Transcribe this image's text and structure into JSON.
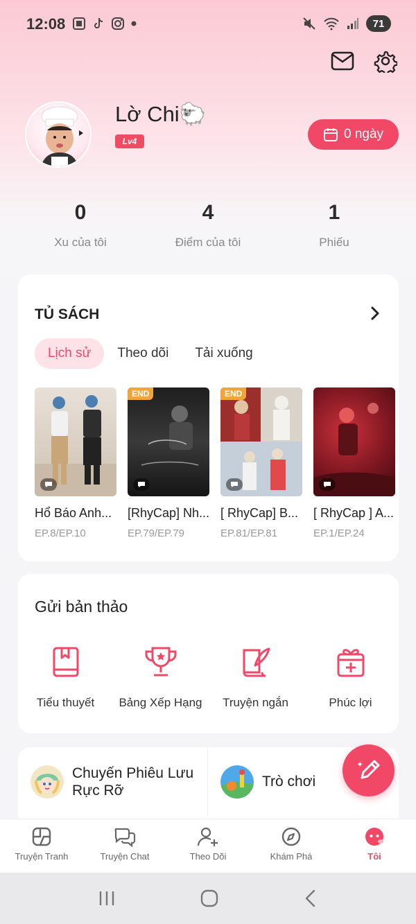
{
  "status_bar": {
    "time": "12:08",
    "battery": "71"
  },
  "profile": {
    "name": "Lờ Chi🐑",
    "level": "Lv4",
    "checkin_label": "0 ngày"
  },
  "stats": [
    {
      "value": "0",
      "label": "Xu của tôi"
    },
    {
      "value": "4",
      "label": "Điểm của tôi"
    },
    {
      "value": "1",
      "label": "Phiếu"
    }
  ],
  "bookshelf": {
    "title": "TỦ SÁCH",
    "tabs": [
      "Lịch sử",
      "Theo dõi",
      "Tải xuống"
    ],
    "active_tab": "Lịch sử",
    "books": [
      {
        "title": "Hổ Báo Anh...",
        "episode": "EP.8/EP.10",
        "tag": ""
      },
      {
        "title": "[RhyCap] Nh...",
        "episode": "EP.79/EP.79",
        "tag": "END"
      },
      {
        "title": "[ RhyCap] B...",
        "episode": "EP.81/EP.81",
        "tag": "END"
      },
      {
        "title": "[ RhyCap ] A...",
        "episode": "EP.1/EP.24",
        "tag": ""
      }
    ]
  },
  "submit": {
    "title": "Gửi bản thảo",
    "items": [
      {
        "label": "Tiểu thuyết",
        "icon": "book-icon"
      },
      {
        "label": "Bảng Xếp Hạng",
        "icon": "trophy-icon"
      },
      {
        "label": "Truyện ngắn",
        "icon": "quill-scroll-icon"
      },
      {
        "label": "Phúc lợi",
        "icon": "gift-icon"
      }
    ]
  },
  "promo": {
    "left_label": "Chuyến Phiêu Lưu Rực Rỡ",
    "right_label": "Trò chơi"
  },
  "bottom_nav": [
    {
      "label": "Truyện Tranh",
      "icon": "comic-icon"
    },
    {
      "label": "Truyện Chat",
      "icon": "chat-icon"
    },
    {
      "label": "Theo Dõi",
      "icon": "follow-icon"
    },
    {
      "label": "Khám Phá",
      "icon": "compass-icon"
    },
    {
      "label": "Tôi",
      "icon": "face-icon"
    }
  ],
  "colors": {
    "accent": "#f04866",
    "end_tag": "#f0a43a"
  }
}
